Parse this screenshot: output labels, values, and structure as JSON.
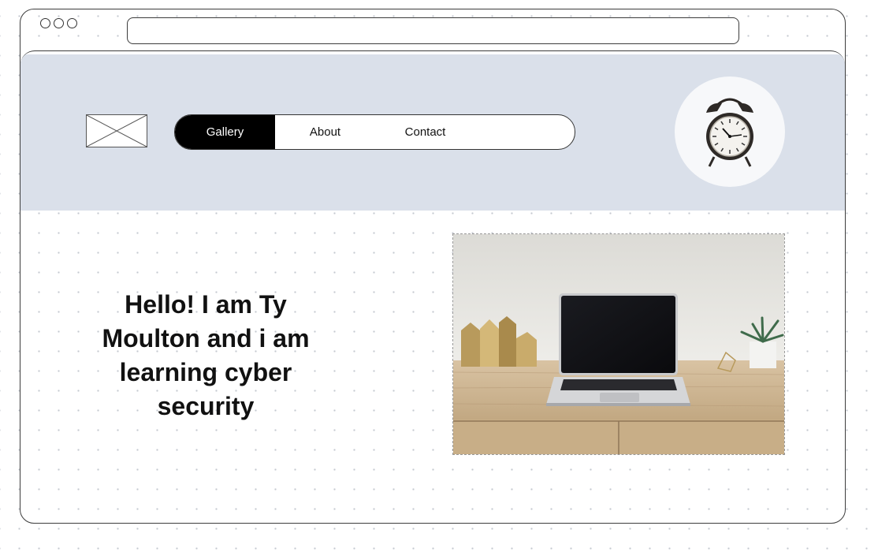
{
  "window": {
    "url": ""
  },
  "nav": {
    "items": [
      {
        "label": "Gallery",
        "active": true
      },
      {
        "label": "About",
        "active": false
      },
      {
        "label": "Contact",
        "active": false
      }
    ]
  },
  "hero": {
    "heading": "Hello! I am Ty Moulton and i am learning cyber security"
  },
  "colors": {
    "header_background": "#dae0ea",
    "nav_active_background": "#000000"
  },
  "icons": {
    "logo": "image-placeholder-icon",
    "avatar": "alarm-clock-image",
    "hero": "laptop-desk-image"
  }
}
